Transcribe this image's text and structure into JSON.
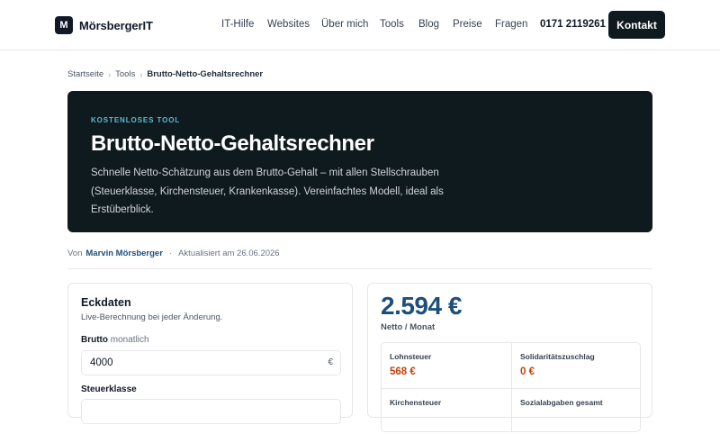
{
  "header": {
    "logo_letter": "M",
    "brand": "MörsbergerIT",
    "nav": [
      "IT-Hilfe",
      "Websites",
      "Über mich",
      "Tools",
      "Blog",
      "Preise",
      "Fragen"
    ],
    "phone": "0171 2119261",
    "cta_label": "Kontakt"
  },
  "breadcrumb": {
    "home": "Startseite",
    "section": "Tools",
    "current": "Brutto-Netto-Gehaltsrechner",
    "separator": "›"
  },
  "hero": {
    "kicker": "KOSTENLOSES TOOL",
    "title": "Brutto-Netto-Gehaltsrechner",
    "description": "Schnelle Netto-Schätzung aus dem Brutto-Gehalt – mit allen Stellschrauben (Steuerklasse, Kirchensteuer, Krankenkasse). Vereinfachtes Modell, ideal als Erstüberblick."
  },
  "meta": {
    "by": "Von",
    "author": "Marvin Mörsberger",
    "dot": "·",
    "updated": "Aktualisiert am 26.06.2026"
  },
  "form": {
    "title": "Eckdaten",
    "subtitle": "Live-Berechnung bei jeder Änderung.",
    "gross_label": "Brutto",
    "gross_hint": "monatlich",
    "gross_value": "4000",
    "currency": "€",
    "tax_class_label": "Steuerklasse"
  },
  "result": {
    "net_amount": "2.594 €",
    "net_label": "Netto / Monat",
    "items": [
      {
        "label": "Lohnsteuer",
        "value": "568 €"
      },
      {
        "label": "Solidaritätszuschlag",
        "value": "0 €"
      },
      {
        "label": "Kirchensteuer",
        "value": ""
      },
      {
        "label": "Sozialabgaben gesamt",
        "value": ""
      }
    ]
  },
  "colors": {
    "dark": "#0f1a1e",
    "accent_blue": "#1e4f7a",
    "kicker": "#5cb8d6",
    "deduction": "#c2410c"
  }
}
